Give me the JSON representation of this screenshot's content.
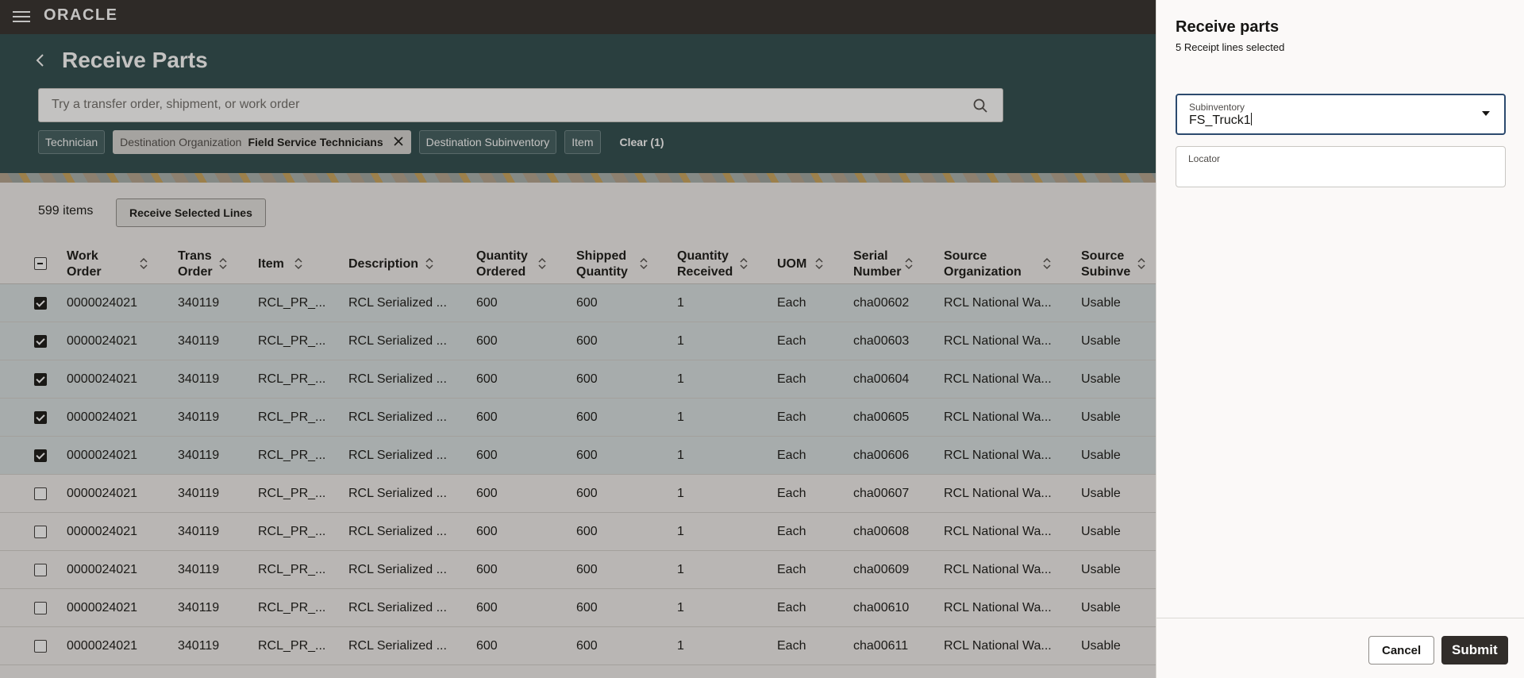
{
  "brand": "ORACLE",
  "page": {
    "title": "Receive Parts",
    "search_placeholder": "Try a transfer order, shipment, or work order"
  },
  "filters": {
    "technician": "Technician",
    "dest_org_label": "Destination Organization",
    "dest_org_value": "Field Service Technicians",
    "dest_subinventory": "Destination Subinventory",
    "item": "Item",
    "clear": "Clear (1)"
  },
  "toolbar": {
    "count": "599 items",
    "receive_button": "Receive Selected Lines"
  },
  "table": {
    "columns": [
      {
        "line1": "Work",
        "line2": "Order"
      },
      {
        "line1": "Trans",
        "line2": "Order"
      },
      {
        "line1": "Item",
        "line2": ""
      },
      {
        "line1": "Description",
        "line2": ""
      },
      {
        "line1": "Quantity",
        "line2": "Ordered"
      },
      {
        "line1": "Shipped",
        "line2": "Quantity"
      },
      {
        "line1": "Quantity",
        "line2": "Received"
      },
      {
        "line1": "UOM",
        "line2": ""
      },
      {
        "line1": "Serial",
        "line2": "Number"
      },
      {
        "line1": "Source",
        "line2": "Organization"
      },
      {
        "line1": "Source",
        "line2": "Subinve"
      }
    ],
    "rows": [
      {
        "selected": true,
        "c": [
          "0000024021",
          "340119",
          "RCL_PR_...",
          "RCL Serialized ...",
          "600",
          "600",
          "1",
          "Each",
          "cha00602",
          "RCL National Wa...",
          "Usable"
        ]
      },
      {
        "selected": true,
        "c": [
          "0000024021",
          "340119",
          "RCL_PR_...",
          "RCL Serialized ...",
          "600",
          "600",
          "1",
          "Each",
          "cha00603",
          "RCL National Wa...",
          "Usable"
        ]
      },
      {
        "selected": true,
        "c": [
          "0000024021",
          "340119",
          "RCL_PR_...",
          "RCL Serialized ...",
          "600",
          "600",
          "1",
          "Each",
          "cha00604",
          "RCL National Wa...",
          "Usable"
        ]
      },
      {
        "selected": true,
        "c": [
          "0000024021",
          "340119",
          "RCL_PR_...",
          "RCL Serialized ...",
          "600",
          "600",
          "1",
          "Each",
          "cha00605",
          "RCL National Wa...",
          "Usable"
        ]
      },
      {
        "selected": true,
        "c": [
          "0000024021",
          "340119",
          "RCL_PR_...",
          "RCL Serialized ...",
          "600",
          "600",
          "1",
          "Each",
          "cha00606",
          "RCL National Wa...",
          "Usable"
        ]
      },
      {
        "selected": false,
        "c": [
          "0000024021",
          "340119",
          "RCL_PR_...",
          "RCL Serialized ...",
          "600",
          "600",
          "1",
          "Each",
          "cha00607",
          "RCL National Wa...",
          "Usable"
        ]
      },
      {
        "selected": false,
        "c": [
          "0000024021",
          "340119",
          "RCL_PR_...",
          "RCL Serialized ...",
          "600",
          "600",
          "1",
          "Each",
          "cha00608",
          "RCL National Wa...",
          "Usable"
        ]
      },
      {
        "selected": false,
        "c": [
          "0000024021",
          "340119",
          "RCL_PR_...",
          "RCL Serialized ...",
          "600",
          "600",
          "1",
          "Each",
          "cha00609",
          "RCL National Wa...",
          "Usable"
        ]
      },
      {
        "selected": false,
        "c": [
          "0000024021",
          "340119",
          "RCL_PR_...",
          "RCL Serialized ...",
          "600",
          "600",
          "1",
          "Each",
          "cha00610",
          "RCL National Wa...",
          "Usable"
        ]
      },
      {
        "selected": false,
        "c": [
          "0000024021",
          "340119",
          "RCL_PR_...",
          "RCL Serialized ...",
          "600",
          "600",
          "1",
          "Each",
          "cha00611",
          "RCL National Wa...",
          "Usable"
        ]
      }
    ]
  },
  "drawer": {
    "title": "Receive parts",
    "subtitle": "5 Receipt lines selected",
    "subinventory_label": "Subinventory",
    "subinventory_value": "FS_Truck1",
    "locator_label": "Locator",
    "locator_value": "",
    "cancel": "Cancel",
    "submit": "Submit"
  },
  "icons": {
    "menu": "hamburger-icon",
    "back": "chevron-left-icon",
    "search": "search-icon",
    "remove_filter": "close-icon",
    "sort": "sort-icon",
    "dropdown": "caret-down-icon"
  },
  "colors": {
    "header": "#2c4a4b",
    "topbar": "#312d2a",
    "selected_row": "#d9e1e2",
    "primary_button": "#312d2a"
  }
}
